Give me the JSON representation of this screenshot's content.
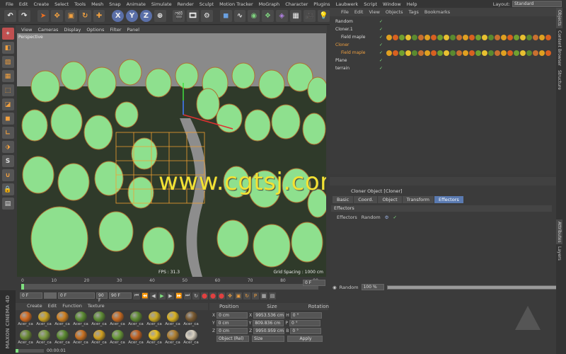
{
  "menu": [
    "File",
    "Edit",
    "Create",
    "Select",
    "Tools",
    "Mesh",
    "Snap",
    "Animate",
    "Simulate",
    "Render",
    "Sculpt",
    "Motion Tracker",
    "MoGraph",
    "Character",
    "Plugins",
    "Laubwerk",
    "Script",
    "Window",
    "Help"
  ],
  "layout": {
    "label": "Layout:",
    "value": "Standard"
  },
  "toolbar": {
    "x": "X",
    "y": "Y",
    "z": "Z"
  },
  "viewport": {
    "menu": [
      "View",
      "Cameras",
      "Display",
      "Options",
      "Filter",
      "Panel"
    ],
    "label": "Perspective",
    "fps": "FPS : 31.3",
    "grid": "Grid Spacing : 1000 cm",
    "watermark": "www.cgtsj.com"
  },
  "timeline": {
    "ticks": [
      "0",
      "10",
      "20",
      "30",
      "40",
      "50",
      "60",
      "70",
      "80",
      "90"
    ],
    "end_label": "0 F"
  },
  "playback": {
    "start": "0 F",
    "current": "0 F",
    "end_small": "90 F",
    "end": "90 F"
  },
  "materials": {
    "menu": [
      "Create",
      "Edit",
      "Function",
      "Texture"
    ],
    "items": [
      {
        "label": "Acer_ca",
        "color": "#d2691e"
      },
      {
        "label": "Acer_ca",
        "color": "#c8a020"
      },
      {
        "label": "Acer_ca",
        "color": "#d08020"
      },
      {
        "label": "Acer_ca",
        "color": "#5a8a30"
      },
      {
        "label": "Acer_ca",
        "color": "#5e8c34"
      },
      {
        "label": "Acer_ca",
        "color": "#c86a20"
      },
      {
        "label": "Acer_ca",
        "color": "#5e8a30"
      },
      {
        "label": "Acer_ca",
        "color": "#c8a820"
      },
      {
        "label": "Acer_ca",
        "color": "#d8b020"
      },
      {
        "label": "Acer_ca",
        "color": "#7a5a30"
      },
      {
        "label": "Acer_ca",
        "color": "#6a8a34"
      },
      {
        "label": "Acer_ca",
        "color": "#7a9a40"
      },
      {
        "label": "Acer_ca",
        "color": "#5a8a30"
      },
      {
        "label": "Acer_ca",
        "color": "#c87020"
      },
      {
        "label": "Acer_ca",
        "color": "#d0a020"
      },
      {
        "label": "Acer_ca",
        "color": "#6a9a38"
      },
      {
        "label": "Acer_ca",
        "color": "#c06020"
      },
      {
        "label": "Acer_ca",
        "color": "#e8c020"
      },
      {
        "label": "Acer_ca",
        "color": "#b08030"
      },
      {
        "label": "Acer_ca",
        "color": "#d8d0c0"
      }
    ]
  },
  "coordinates": {
    "headers": [
      "Position",
      "Size",
      "Rotation"
    ],
    "rows": [
      {
        "axis": "X",
        "pos": "0 cm",
        "saxis": "X",
        "size": "9953.536 cm",
        "raxis": "H",
        "rot": "0 °"
      },
      {
        "axis": "Y",
        "pos": "0 cm",
        "saxis": "Y",
        "size": "809.836 cm",
        "raxis": "P",
        "rot": "0 °"
      },
      {
        "axis": "Z",
        "pos": "0 cm",
        "saxis": "Z",
        "size": "9950.959 cm",
        "raxis": "B",
        "rot": "0 °"
      }
    ],
    "mode": "Object (Rel)",
    "size_mode": "Size",
    "apply": "Apply"
  },
  "object_manager": {
    "menu": [
      "File",
      "Edit",
      "View",
      "Objects",
      "Tags",
      "Bookmarks"
    ],
    "rows": [
      {
        "name": "Random",
        "indent": 0,
        "color": "#dddddd"
      },
      {
        "name": "Cloner.1",
        "indent": 0,
        "color": "#dddddd"
      },
      {
        "name": "Field maple",
        "indent": 1,
        "color": "#dddddd"
      },
      {
        "name": "Cloner",
        "indent": 0,
        "color": "#f0a040"
      },
      {
        "name": "Field maple",
        "indent": 1,
        "color": "#f0a040"
      },
      {
        "name": "Plane",
        "indent": 0,
        "color": "#dddddd"
      },
      {
        "name": "terrain",
        "indent": 0,
        "color": "#dddddd"
      }
    ]
  },
  "attributes": {
    "title": "Cloner Object [Cloner]",
    "tabs": [
      "Basic",
      "Coord.",
      "Object",
      "Transform",
      "Effectors"
    ],
    "active_tab": "Effectors",
    "section": "Effectors",
    "field_label": "Effectors",
    "effector": "Random",
    "random_label": "Random",
    "random_value": "100 %",
    "random_fraction": 1.0
  },
  "right_tabs": [
    "Objects",
    "Content Browser",
    "Structure",
    "Attributes",
    "Layers"
  ],
  "status": {
    "time": "00:00:01"
  },
  "brand": "MAXON CINEMA 4D"
}
